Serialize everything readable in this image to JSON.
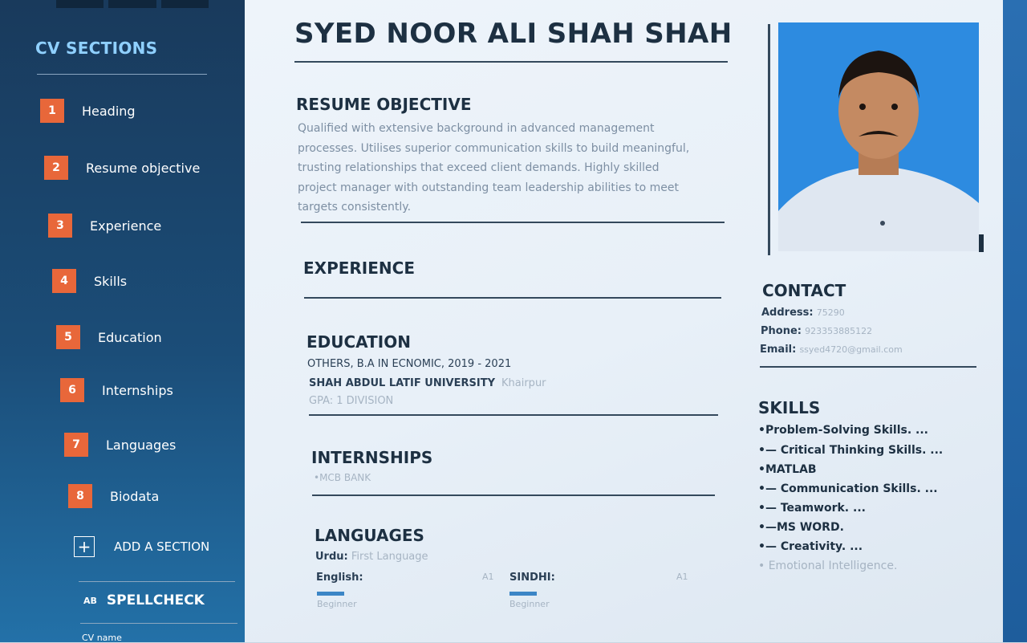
{
  "sidebar": {
    "title": "CV SECTIONS",
    "items": [
      {
        "num": "1",
        "label": "Heading"
      },
      {
        "num": "2",
        "label": "Resume objective"
      },
      {
        "num": "3",
        "label": "Experience"
      },
      {
        "num": "4",
        "label": "Skills"
      },
      {
        "num": "5",
        "label": "Education"
      },
      {
        "num": "6",
        "label": "Internships"
      },
      {
        "num": "7",
        "label": "Languages"
      },
      {
        "num": "8",
        "label": "Biodata"
      }
    ],
    "add_section": "ADD A SECTION",
    "spellcheck_icon": "AB",
    "spellcheck": "SPELLCHECK",
    "cv_name_partial": "CV name"
  },
  "resume": {
    "name": "SYED NOOR ALI SHAH SHAH",
    "objective": {
      "heading": "RESUME OBJECTIVE",
      "lines": [
        "Qualified with extensive background in advanced management",
        "processes. Utilises superior communication skills to build meaningful,",
        "trusting relationships that exceed client demands. Highly skilled",
        "project manager with outstanding team leadership abilities to meet",
        "targets consistently."
      ]
    },
    "experience": {
      "heading": "EXPERIENCE"
    },
    "education": {
      "heading": "EDUCATION",
      "degree": "OTHERS, B.A IN ECNOMIC, 2019 - 2021",
      "school": "SHAH ABDUL LATIF UNIVERSITY",
      "city": "Khairpur",
      "gpa": "GPA: 1 DIVISION"
    },
    "internships": {
      "heading": "INTERNSHIPS",
      "item": "•MCB BANK"
    },
    "languages": {
      "heading": "LANGUAGES",
      "urdu_label": "Urdu:",
      "urdu_value": "First Language",
      "english_label": "English:",
      "english_level_code": "A1",
      "english_level": "Beginner",
      "sindhi_label": "SINDHI:",
      "sindhi_level_code": "A1",
      "sindhi_level": "Beginner"
    },
    "contact": {
      "heading": "CONTACT",
      "address_label": "Address:",
      "address": "75290",
      "phone_label": "Phone:",
      "phone": "923353885122",
      "email_label": "Email:",
      "email": "ssyed4720@gmail.com"
    },
    "skills": {
      "heading": "SKILLS",
      "items": [
        "•Problem-Solving Skills. ...",
        "•— Critical Thinking Skills. ...",
        "•MATLAB",
        "•— Communication Skills. ...",
        "•— Teamwork. ...",
        "•—MS WORD.",
        "•— Creativity. ...",
        "•    Emotional Intelligence."
      ]
    }
  },
  "colors": {
    "sidebar_bg": "#1b4d78",
    "accent_number": "#e8673a",
    "section_title": "#8fd0ff",
    "photo_bg": "#2d8be0",
    "language_bar": "#3c86c6"
  }
}
